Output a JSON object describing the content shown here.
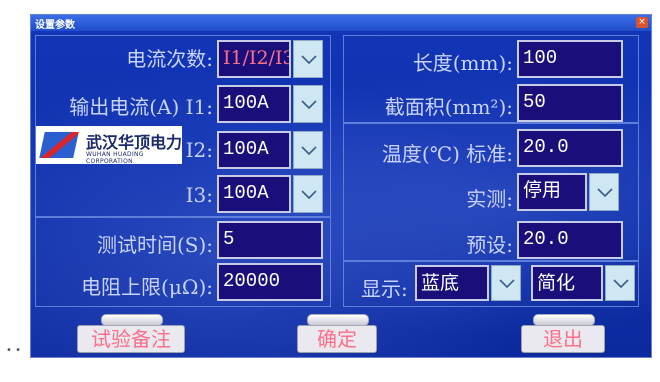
{
  "window": {
    "title": "设置参数",
    "close_glyph": "×"
  },
  "left": {
    "current_count_label": "电流次数:",
    "current_count_value": "I1/I2/I3",
    "output_label": "输出电流(A) I1:",
    "i1_value": "100A",
    "i2_label": "I2:",
    "i2_value": "100A",
    "i3_label": "I3:",
    "i3_value": "100A",
    "test_time_label": "测试时间(S):",
    "test_time_value": "5",
    "resistance_label": "电阻上限(μΩ):",
    "resistance_value": "20000"
  },
  "right": {
    "length_label": "长度(mm):",
    "length_value": "100",
    "area_label": "截面积(mm²):",
    "area_value": "50",
    "temp_label": "温度(℃) 标准:",
    "temp_std_value": "20.0",
    "measured_label": "实测:",
    "measured_value": "停用",
    "preset_label": "预设:",
    "preset_value": "20.0",
    "display_label": "显示:",
    "display_color": "蓝底",
    "display_mode": "简化"
  },
  "buttons": {
    "note": "试验备注",
    "ok": "确定",
    "exit": "退出"
  },
  "logo": {
    "cn": "武汉华顶电力",
    "en": "WUHAN HUADING CORPORATION"
  },
  "icons": {
    "dropdown": "chevron-down-icon",
    "close": "close-icon"
  },
  "colors": {
    "background": "#0f2fa6",
    "field": "#1a0f7a",
    "label": "#c9d3ff",
    "accent": "#ff6f8a"
  },
  "footer_dots": "• •"
}
